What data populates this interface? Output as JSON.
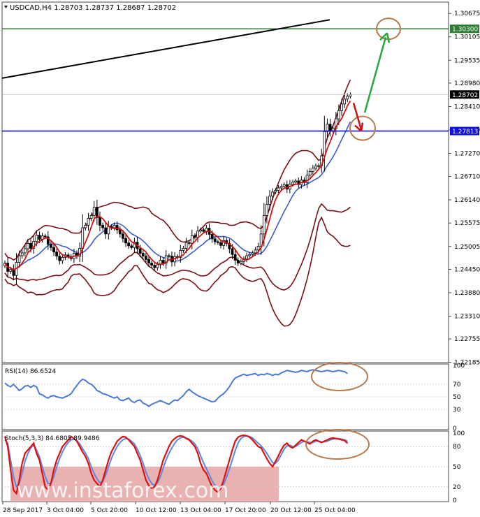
{
  "header": {
    "symbol_line": "USDCAD,H4  1.28703 1.28737 1.28687 1.28702"
  },
  "colors": {
    "candle": "#000000",
    "bollinger": "#7a0f1a",
    "ma_fast": "#d01010",
    "ma_slow": "#3a5fcd",
    "trendline": "#000000",
    "resistance": "#2e7d32",
    "support": "#1010e0",
    "rsi_line": "#4a7bd0",
    "stoch_main": "#e01010",
    "stoch_signal": "#5a8ae0",
    "annotation_circle": "#b87a4b",
    "arrow_up": "#27a83a",
    "arrow_down": "#d01010",
    "watermark_box": "#e6a3a3"
  },
  "chart_data": [
    {
      "type": "candlestick",
      "panel": "price",
      "symbol": "USDCAD",
      "timeframe": "H4",
      "ohlc_current": {
        "open": 1.28703,
        "high": 1.28737,
        "low": 1.28687,
        "close": 1.28702
      },
      "ylim": [
        1.2218,
        1.3095
      ],
      "y_ticks": [
        "1.30675",
        "1.30105",
        "1.29535",
        "1.28980",
        "1.28410",
        "1.27840",
        "1.27270",
        "1.26710",
        "1.26140",
        "1.25575",
        "1.25005",
        "1.24450",
        "1.23880",
        "1.23310",
        "1.22755",
        "1.22185"
      ],
      "x_ticks": [
        "28 Sep 2017",
        "3 Oct 04:00",
        "5 Oct 20:00",
        "10 Oct 12:00",
        "13 Oct 04:00",
        "17 Oct 20:00",
        "20 Oct 12:00",
        "25 Oct 04:00"
      ],
      "price_labels": [
        {
          "text": "1.30300",
          "value": 1.303,
          "style": "resistance"
        },
        {
          "text": "1.28702",
          "value": 1.28702,
          "style": "current"
        },
        {
          "text": "1.27813",
          "value": 1.27813,
          "style": "support"
        }
      ],
      "closes": [
        1.246,
        1.244,
        1.2445,
        1.243,
        1.2462,
        1.2478,
        1.2485,
        1.2495,
        1.2508,
        1.2496,
        1.2513,
        1.2528,
        1.2518,
        1.2526,
        1.2524,
        1.2506,
        1.2498,
        1.2487,
        1.2477,
        1.2466,
        1.2474,
        1.248,
        1.2476,
        1.2471,
        1.2484,
        1.2477,
        1.2496,
        1.2546,
        1.2552,
        1.2569,
        1.2576,
        1.2596,
        1.2571,
        1.2552,
        1.2546,
        1.2531,
        1.2549,
        1.2546,
        1.2552,
        1.2541,
        1.2531,
        1.252,
        1.2509,
        1.2502,
        1.2498,
        1.2511,
        1.2495,
        1.2484,
        1.2477,
        1.2469,
        1.246,
        1.2455,
        1.2449,
        1.2456,
        1.2467,
        1.246,
        1.2478,
        1.2477,
        1.2463,
        1.2476,
        1.2474,
        1.2491,
        1.2496,
        1.251,
        1.2508,
        1.2527,
        1.2523,
        1.2538,
        1.2541,
        1.2537,
        1.2545,
        1.253,
        1.2519,
        1.2512,
        1.251,
        1.2503,
        1.2515,
        1.2508,
        1.2495,
        1.2481,
        1.2467,
        1.246,
        1.2464,
        1.247,
        1.2478,
        1.2481,
        1.2485,
        1.2492,
        1.2501,
        1.2531,
        1.2576,
        1.2603,
        1.2623,
        1.2633,
        1.2637,
        1.2643,
        1.2647,
        1.2651,
        1.264,
        1.2652,
        1.2657,
        1.266,
        1.2651,
        1.2662,
        1.2656,
        1.2674,
        1.2683,
        1.2691,
        1.2696,
        1.2697,
        1.2721,
        1.278,
        1.2798,
        1.2781,
        1.2788,
        1.2811,
        1.2831,
        1.2847,
        1.2859,
        1.2866,
        1.287
      ]
    },
    {
      "type": "line",
      "panel": "rsi",
      "title": "RSI(14) 86.6524",
      "ylim": [
        0,
        100
      ],
      "y_ticks": [
        "100",
        "70",
        "50",
        "30",
        "0"
      ],
      "values": [
        72,
        68,
        66,
        70,
        65,
        60,
        63,
        67,
        68,
        65,
        68,
        66,
        55,
        53,
        50,
        48,
        51,
        52,
        50,
        49,
        48,
        50,
        52,
        55,
        62,
        68,
        74,
        78,
        76,
        72,
        70,
        66,
        60,
        58,
        55,
        54,
        52,
        50,
        48,
        50,
        45,
        44,
        46,
        48,
        43,
        41,
        44,
        45,
        40,
        38,
        35,
        38,
        40,
        42,
        44,
        42,
        40,
        38,
        42,
        45,
        44,
        48,
        52,
        58,
        62,
        58,
        55,
        52,
        50,
        48,
        46,
        44,
        42,
        43,
        48,
        52,
        55,
        60,
        66,
        74,
        80,
        82,
        84,
        86,
        84,
        85,
        86,
        87,
        84,
        86,
        85,
        87,
        86,
        84,
        86,
        85,
        88,
        90,
        92,
        91,
        90,
        89,
        90,
        92,
        91,
        90,
        92,
        93,
        92,
        91,
        90,
        91,
        92,
        91,
        90,
        91,
        92,
        91,
        90,
        87
      ]
    },
    {
      "type": "line",
      "panel": "stochastic",
      "title": "Stoch(5,3,3) 84.6805 89.9486",
      "ylim": [
        0,
        100
      ],
      "y_ticks": [
        "100",
        "80",
        "50",
        "20",
        "0"
      ],
      "series": [
        {
          "values": [
            95,
            80,
            45,
            15,
            10,
            30,
            55,
            70,
            75,
            80,
            85,
            70,
            60,
            40,
            20,
            15,
            25,
            45,
            60,
            70,
            80,
            85,
            90,
            95,
            92,
            88,
            80,
            72,
            65,
            55,
            40,
            30,
            25,
            20,
            30,
            45,
            60,
            72,
            80,
            88,
            92,
            95,
            94,
            90,
            85,
            80,
            70,
            60,
            45,
            30,
            22,
            18,
            20,
            30,
            45,
            60,
            70,
            80,
            88,
            92,
            95,
            96,
            95,
            92,
            90,
            85,
            80,
            70,
            55,
            45,
            40,
            30,
            20,
            15,
            12,
            18,
            30,
            45,
            60,
            75,
            88,
            94,
            96,
            97,
            96,
            94,
            90,
            85,
            80,
            78,
            70,
            62,
            55,
            50,
            58,
            66,
            75,
            82,
            85,
            80,
            78,
            82,
            86,
            90,
            88,
            86,
            84,
            88,
            90,
            88,
            86,
            88,
            90,
            92,
            93,
            92,
            91,
            90,
            89,
            85
          ]
        },
        {
          "values": [
            90,
            85,
            60,
            35,
            20,
            25,
            40,
            58,
            70,
            78,
            82,
            75,
            65,
            50,
            35,
            25,
            25,
            35,
            50,
            62,
            72,
            80,
            86,
            90,
            91,
            89,
            84,
            77,
            70,
            62,
            50,
            40,
            32,
            26,
            28,
            37,
            50,
            62,
            72,
            80,
            86,
            90,
            92,
            91,
            88,
            84,
            76,
            67,
            55,
            42,
            32,
            25,
            22,
            26,
            35,
            48,
            60,
            70,
            78,
            85,
            90,
            93,
            94,
            93,
            91,
            88,
            84,
            77,
            66,
            56,
            47,
            38,
            29,
            22,
            18,
            18,
            24,
            34,
            47,
            60,
            74,
            85,
            92,
            95,
            96,
            95,
            93,
            89,
            85,
            81,
            76,
            70,
            63,
            56,
            55,
            60,
            68,
            76,
            81,
            82,
            80,
            80,
            83,
            86,
            88,
            87,
            86,
            86,
            88,
            88,
            87,
            87,
            88,
            90,
            91,
            92,
            92,
            91,
            90,
            88
          ]
        }
      ]
    }
  ],
  "watermark": {
    "text": "www.instaforex.com"
  }
}
